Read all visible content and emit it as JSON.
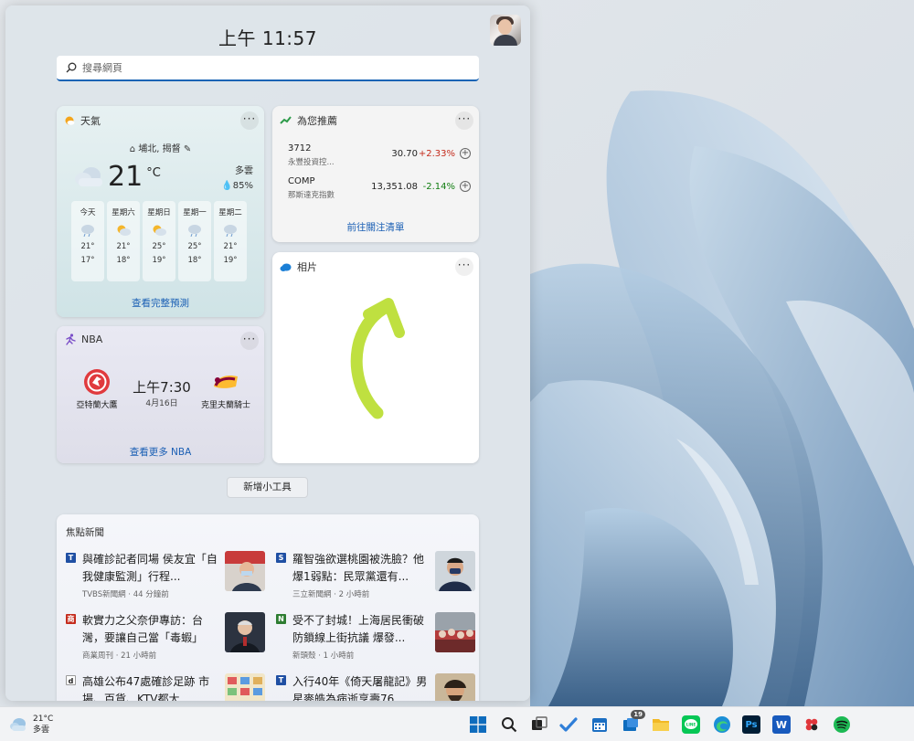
{
  "clock": "上午 11:57",
  "search": {
    "placeholder": "搜尋網頁"
  },
  "weather": {
    "title": "天氣",
    "location": "埔北, 揭督",
    "temp": "21",
    "unit": "°C",
    "condition": "多雲",
    "humidity": "85%",
    "days": [
      {
        "name": "今天",
        "icon": "rain-cloud-icon",
        "high": "21°",
        "low": "17°"
      },
      {
        "name": "星期六",
        "icon": "sun-cloud-icon",
        "high": "21°",
        "low": "18°"
      },
      {
        "name": "星期日",
        "icon": "sun-cloud-icon",
        "high": "25°",
        "low": "19°"
      },
      {
        "name": "星期一",
        "icon": "rain-cloud-icon",
        "high": "25°",
        "low": "18°"
      },
      {
        "name": "星期二",
        "icon": "rain-cloud-icon",
        "high": "21°",
        "low": "19°"
      }
    ],
    "link": "查看完整預測"
  },
  "stocks": {
    "title": "為您推薦",
    "items": [
      {
        "symbol": "3712",
        "name": "永豐投資控...",
        "price": "30.70",
        "change": "+2.33%",
        "color": "#c42b1c"
      },
      {
        "symbol": "COMP",
        "name": "那斯達克指數",
        "price": "13,351.08",
        "change": "-2.14%",
        "color": "#107c10"
      }
    ],
    "link": "前往關注清單"
  },
  "photos": {
    "title": "相片"
  },
  "nba": {
    "title": "NBA",
    "team1": "亞特蘭大鷹",
    "team2": "克里夫蘭騎士",
    "time": "上午7:30",
    "date": "4月16日",
    "link": "查看更多 NBA"
  },
  "add_widget": "新增小工具",
  "news": {
    "title": "焦點新聞",
    "items": [
      {
        "headline": "與確診記者同場 侯友宜「自我健康監測」行程...",
        "meta": "TVBS新聞網 · 44 分鐘前",
        "icon_text": "T",
        "icon_color": "#1f4fa3"
      },
      {
        "headline": "羅智強欲選桃園被洗臉？他爆1弱點：民眾黨還有...",
        "meta": "三立新聞網 · 2 小時前",
        "icon_text": "S",
        "icon_color": "#1f4fa3"
      },
      {
        "headline": "軟實力之父奈伊專訪：台灣，要讓自己當「毒蝦」",
        "meta": "商業周刊 · 21 小時前",
        "icon_text": "商",
        "icon_color": "#c42b1c"
      },
      {
        "headline": "受不了封城！上海居民衝破防鎖線上街抗議 爆發...",
        "meta": "新頭殼 · 1 小時前",
        "icon_text": "N",
        "icon_color": "#2e7d32"
      },
      {
        "headline": "高雄公布47處確診足跡 市場、百貨、KTV都大...",
        "meta": "",
        "icon_text": "d",
        "icon_color": "#222222"
      },
      {
        "headline": "入行40年《倚天屠龍記》男星麥皓為病逝享壽76...",
        "meta": "",
        "icon_text": "T",
        "icon_color": "#1f4fa3"
      }
    ]
  },
  "taskbar": {
    "weather_temp": "21°C",
    "weather_cond": "多雲",
    "badge": "19",
    "icons": [
      "windows-start-icon",
      "search-icon",
      "task-view-icon",
      "todo-icon",
      "calendar-icon",
      "outlook-icon",
      "file-explorer-icon",
      "line-icon",
      "edge-icon",
      "store-icon",
      "photoshop-icon",
      "word-icon",
      "app-icon",
      "spotify-icon"
    ],
    "ps_label": "Ps",
    "word_label": "W",
    "line_label": "LINE"
  }
}
